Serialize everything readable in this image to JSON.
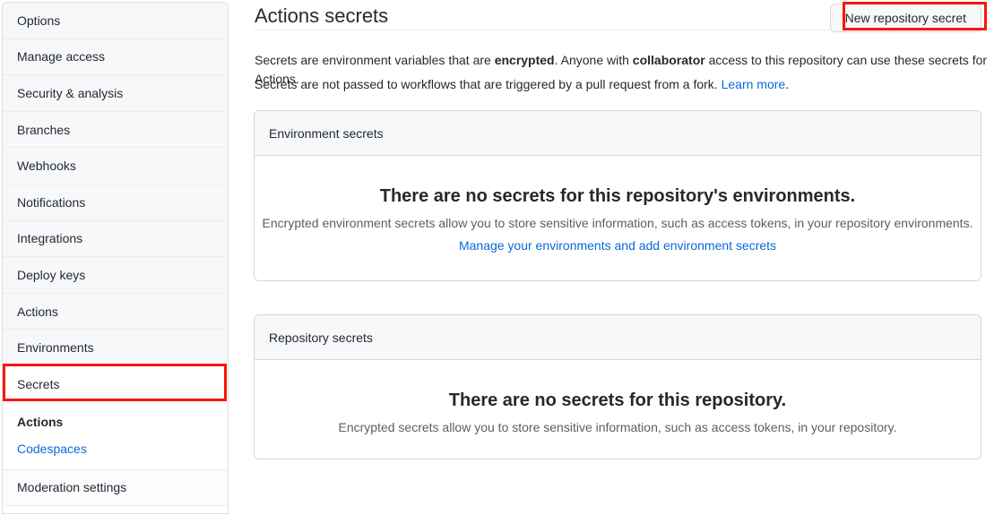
{
  "sidebar": {
    "items": [
      {
        "label": "Options",
        "type": "row"
      },
      {
        "label": "Manage access",
        "type": "row"
      },
      {
        "label": "Security & analysis",
        "type": "row"
      },
      {
        "label": "Branches",
        "type": "row"
      },
      {
        "label": "Webhooks",
        "type": "row"
      },
      {
        "label": "Notifications",
        "type": "row"
      },
      {
        "label": "Integrations",
        "type": "row"
      },
      {
        "label": "Deploy keys",
        "type": "row"
      },
      {
        "label": "Actions",
        "type": "row"
      },
      {
        "label": "Environments",
        "type": "row"
      },
      {
        "label": "Secrets",
        "type": "row",
        "selected": true
      },
      {
        "label": "Moderation settings",
        "type": "row"
      }
    ],
    "secrets_subitems": [
      {
        "label": "Actions",
        "active": true
      },
      {
        "label": "Codespaces",
        "active": false
      }
    ],
    "highlight_color": "#fa1505"
  },
  "header": {
    "title": "Actions secrets",
    "new_secret_label": "New repository secret"
  },
  "description": {
    "line1_part1": "Secrets are environment variables that are ",
    "line1_bold1": "encrypted",
    "line1_part2": ". Anyone with ",
    "line1_bold2": "collaborator",
    "line1_part3": " access to this repository can use these secrets for Actions.",
    "line2_part1": "Secrets are not passed to workflows that are triggered by a pull request from a fork. ",
    "line2_link": "Learn more",
    "line2_part2": "."
  },
  "environment_secrets": {
    "card_title": "Environment secrets",
    "empty_title": "There are no secrets for this repository's environments.",
    "empty_sub": "Encrypted environment secrets allow you to store sensitive information, such as access tokens, in your repository environments.",
    "empty_link": "Manage your environments and add environment secrets"
  },
  "repository_secrets": {
    "card_title": "Repository secrets",
    "empty_title": "There are no secrets for this repository.",
    "empty_sub": "Encrypted secrets allow you to store sensitive information, such as access tokens, in your repository."
  },
  "colors": {
    "link": "#0969da",
    "text": "#24292f",
    "muted": "#57606a",
    "border": "#d0d7de",
    "card_header_bg": "#f6f8fa",
    "annotation": "#fa1505"
  }
}
